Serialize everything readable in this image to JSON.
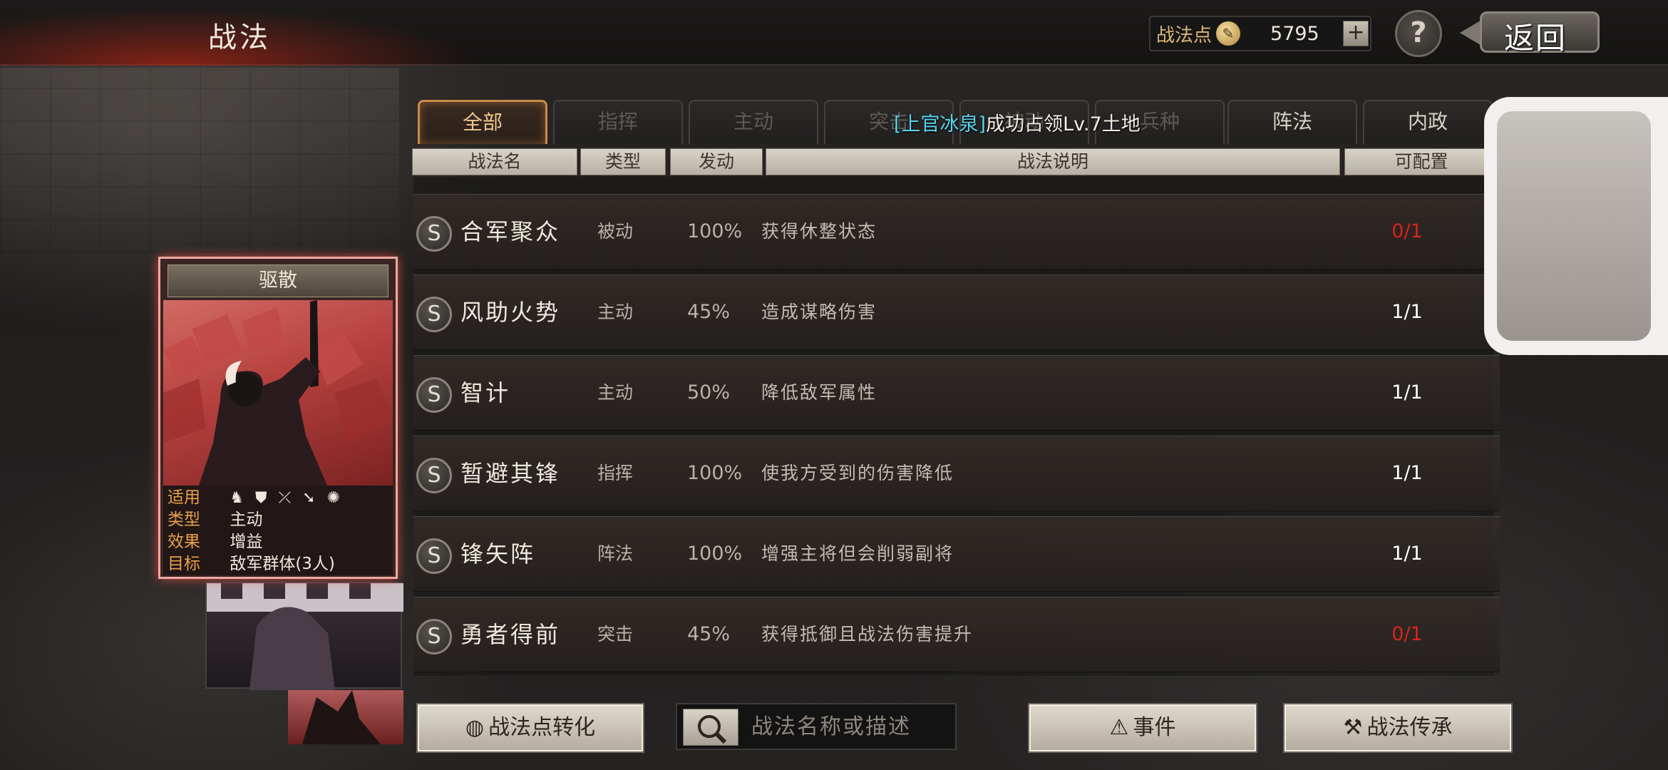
{
  "header": {
    "title": "战法",
    "points_label": "战法点",
    "points_value": "5795",
    "plus": "+",
    "help": "?",
    "back_label": "返回"
  },
  "tabs": [
    {
      "label": "全部",
      "state": "active"
    },
    {
      "label": "指挥",
      "state": "dim"
    },
    {
      "label": "主动",
      "state": "dim"
    },
    {
      "label": "突击",
      "state": "dim"
    },
    {
      "label": "被动",
      "state": "dim"
    },
    {
      "label": "兵种",
      "state": "dim"
    },
    {
      "label": "阵法",
      "state": "normal"
    },
    {
      "label": "内政",
      "state": "normal"
    }
  ],
  "notice": {
    "name": "[上官冰泉]",
    "text": "成功占领Lv.7土地"
  },
  "table": {
    "headers": {
      "name": "战法名",
      "type": "类型",
      "rate": "发动",
      "desc": "战法说明",
      "cfg": "可配置"
    },
    "rows": [
      {
        "grade": "S",
        "name": "合军聚众",
        "type": "被动",
        "rate": "100%",
        "desc": "获得休整状态",
        "cfg": "0/1",
        "cfg_color": "#d8231b"
      },
      {
        "grade": "S",
        "name": "风助火势",
        "type": "主动",
        "rate": "45%",
        "desc": "造成谋略伤害",
        "cfg": "1/1",
        "cfg_color": "#ffffff"
      },
      {
        "grade": "S",
        "name": "智计",
        "type": "主动",
        "rate": "50%",
        "desc": "降低敌军属性",
        "cfg": "1/1",
        "cfg_color": "#ffffff"
      },
      {
        "grade": "S",
        "name": "暂避其锋",
        "type": "指挥",
        "rate": "100%",
        "desc": "使我方受到的伤害降低",
        "cfg": "1/1",
        "cfg_color": "#ffffff"
      },
      {
        "grade": "S",
        "name": "锋矢阵",
        "type": "阵法",
        "rate": "100%",
        "desc": "增强主将但会削弱副将",
        "cfg": "1/1",
        "cfg_color": "#ffffff"
      },
      {
        "grade": "S",
        "name": "勇者得前",
        "type": "突击",
        "rate": "45%",
        "desc": "获得抵御且战法伤害提升",
        "cfg": "0/1",
        "cfg_color": "#d8231b"
      }
    ]
  },
  "card": {
    "title": "驱散",
    "labels": {
      "units": "适用",
      "type": "类型",
      "effect": "效果",
      "target": "目标"
    },
    "type": "主动",
    "effect": "增益",
    "target": "敌军群体(3人)",
    "unit_icons": [
      "cavalry-icon",
      "shield-icon",
      "bow-icon",
      "spear-icon",
      "wheel-icon"
    ]
  },
  "bottom": {
    "convert_label": "战法点转化",
    "search_placeholder": "战法名称或描述",
    "events_label": "事件",
    "inherit_label": "战法传承"
  },
  "colors": {
    "accent_tab": "#c98b4a",
    "notice_name": "#56d4ee",
    "cfg_full": "#d8231b"
  }
}
